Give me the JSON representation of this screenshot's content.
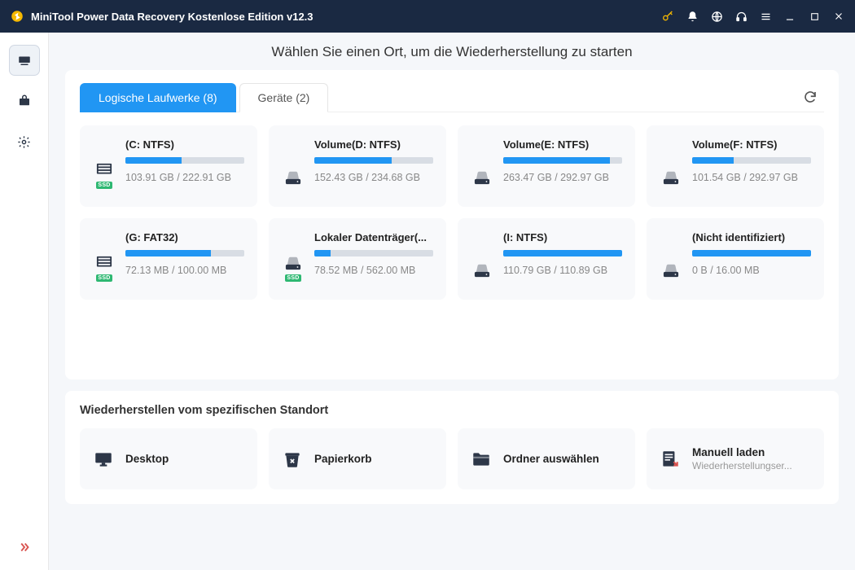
{
  "titlebar": {
    "title": "MiniTool Power Data Recovery Kostenlose Edition v12.3"
  },
  "heading": "Wählen Sie einen Ort, um die Wiederherstellung zu starten",
  "tabs": {
    "logical": "Logische Laufwerke (8)",
    "devices": "Geräte (2)"
  },
  "drives": [
    {
      "name": "(C: NTFS)",
      "size": "103.91 GB / 222.91 GB",
      "pct": 47,
      "ssd": true,
      "icon": "internal"
    },
    {
      "name": "Volume(D: NTFS)",
      "size": "152.43 GB / 234.68 GB",
      "pct": 65,
      "ssd": false,
      "icon": "external"
    },
    {
      "name": "Volume(E: NTFS)",
      "size": "263.47 GB / 292.97 GB",
      "pct": 90,
      "ssd": false,
      "icon": "external"
    },
    {
      "name": "Volume(F: NTFS)",
      "size": "101.54 GB / 292.97 GB",
      "pct": 35,
      "ssd": false,
      "icon": "external",
      "barFull": true
    },
    {
      "name": "(G: FAT32)",
      "size": "72.13 MB / 100.00 MB",
      "pct": 72,
      "ssd": true,
      "icon": "internal"
    },
    {
      "name": "Lokaler Datenträger(...",
      "size": "78.52 MB / 562.00 MB",
      "pct": 14,
      "ssd": true,
      "icon": "external"
    },
    {
      "name": "(I: NTFS)",
      "size": "110.79 GB / 110.89 GB",
      "pct": 100,
      "ssd": false,
      "icon": "external"
    },
    {
      "name": "(Nicht identifiziert)",
      "size": "0 B / 16.00 MB",
      "pct": 100,
      "ssd": false,
      "icon": "external",
      "fullBlue": true
    }
  ],
  "specific": {
    "title": "Wiederherstellen vom spezifischen Standort",
    "items": [
      {
        "title": "Desktop",
        "sub": ""
      },
      {
        "title": "Papierkorb",
        "sub": ""
      },
      {
        "title": "Ordner auswählen",
        "sub": ""
      },
      {
        "title": "Manuell laden",
        "sub": "Wiederherstellungser..."
      }
    ]
  },
  "ssd_label": "SSD"
}
